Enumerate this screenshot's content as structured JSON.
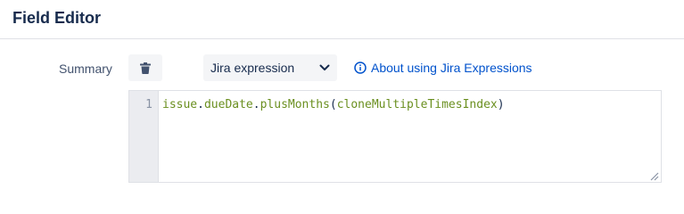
{
  "header": {
    "title": "Field Editor"
  },
  "field": {
    "label": "Summary",
    "delete_icon": "trash-icon",
    "mode_select": {
      "selected": "Jira expression",
      "icon": "chevron-down-icon"
    },
    "help_link": {
      "icon": "info-icon",
      "label": "About using Jira Expressions"
    }
  },
  "editor": {
    "line_number": "1",
    "tokens": {
      "t1": "issue",
      "t2": ".",
      "t3": "dueDate",
      "t4": ".",
      "t5": "plusMonths",
      "t6": "(",
      "t7": "cloneMultipleTimesIndex",
      "t8": ")"
    },
    "resize_icon": "resize-handle-icon"
  },
  "colors": {
    "title_text": "#172b4d",
    "link": "#0052cc",
    "code_identifier": "#6a8f1f",
    "gutter_bg": "#ebecf0",
    "button_bg": "#f4f5f7"
  }
}
